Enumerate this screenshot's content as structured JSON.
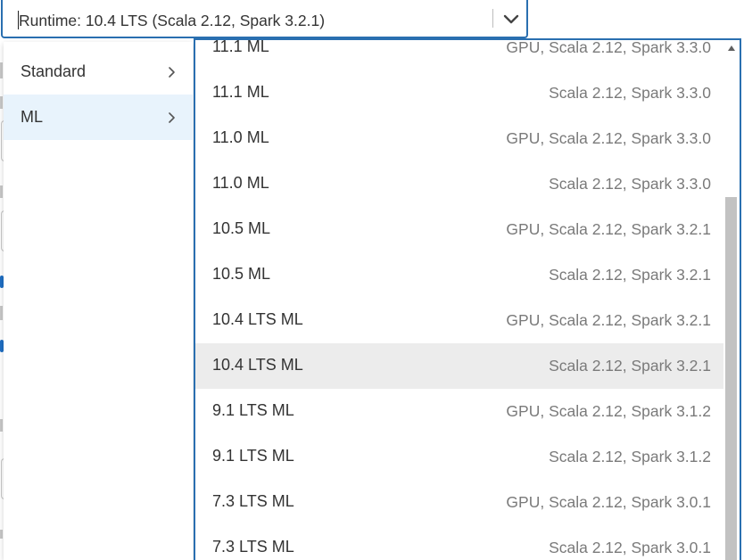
{
  "select": {
    "value": "Runtime: 10.4 LTS (Scala 2.12, Spark 3.2.1)",
    "toggle_icon": "chevron-down-icon"
  },
  "categories": [
    {
      "label": "Standard",
      "selected": false
    },
    {
      "label": "ML",
      "selected": true
    }
  ],
  "versions": [
    {
      "name": "11.1 ML",
      "detail": "GPU, Scala 2.12, Spark 3.3.0"
    },
    {
      "name": "11.1 ML",
      "detail": "Scala 2.12, Spark 3.3.0"
    },
    {
      "name": "11.0 ML",
      "detail": "GPU, Scala 2.12, Spark 3.3.0"
    },
    {
      "name": "11.0 ML",
      "detail": "Scala 2.12, Spark 3.3.0"
    },
    {
      "name": "10.5 ML",
      "detail": "GPU, Scala 2.12, Spark 3.2.1"
    },
    {
      "name": "10.5 ML",
      "detail": "Scala 2.12, Spark 3.2.1"
    },
    {
      "name": "10.4 LTS ML",
      "detail": "GPU, Scala 2.12, Spark 3.2.1"
    },
    {
      "name": "10.4 LTS ML",
      "detail": "Scala 2.12, Spark 3.2.1",
      "highlighted": true
    },
    {
      "name": "9.1 LTS ML",
      "detail": "GPU, Scala 2.12, Spark 3.1.2"
    },
    {
      "name": "9.1 LTS ML",
      "detail": "Scala 2.12, Spark 3.1.2"
    },
    {
      "name": "7.3 LTS ML",
      "detail": "GPU, Scala 2.12, Spark 3.0.1"
    },
    {
      "name": "7.3 LTS ML",
      "detail": "Scala 2.12, Spark 3.0.1"
    }
  ],
  "scrollbar": {
    "thumb_start_fraction": 0.3,
    "thumb_size_fraction": 0.7
  },
  "colors": {
    "accent": "#2a6fb0",
    "selected_category_bg": "#e8f3fc",
    "highlighted_option_bg": "#ececec"
  }
}
